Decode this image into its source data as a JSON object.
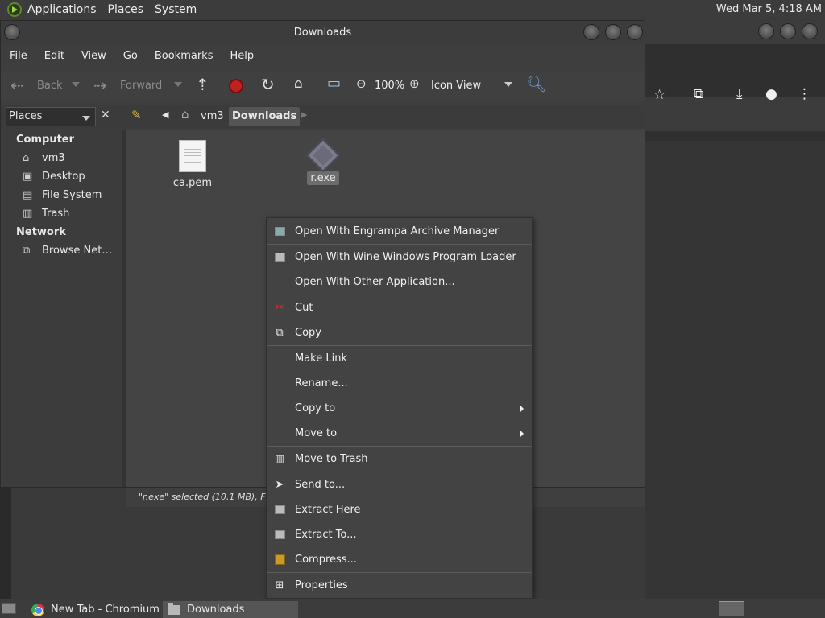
{
  "top_panel": {
    "menus": [
      "Applications",
      "Places",
      "System"
    ],
    "clock": "Wed Mar  5, 4:18 AM"
  },
  "window": {
    "title": "Downloads",
    "menubar": [
      "File",
      "Edit",
      "View",
      "Go",
      "Bookmarks",
      "Help"
    ],
    "toolbar": {
      "back": "Back",
      "forward": "Forward",
      "zoom": "100%",
      "view_mode": "Icon View"
    },
    "location": {
      "sidebar_select": "Places",
      "crumbs": [
        "vm3",
        "Downloads"
      ]
    },
    "sidebar": {
      "computer_heading": "Computer",
      "computer_items": [
        "vm3",
        "Desktop",
        "File System",
        "Trash"
      ],
      "network_heading": "Network",
      "network_items": [
        "Browse Net…"
      ]
    },
    "files": [
      {
        "name": "ca.pem",
        "icon": "text-file-icon"
      },
      {
        "name": "r.exe",
        "icon": "exe-file-icon",
        "selected": true
      }
    ],
    "status": "\"r.exe\" selected (10.1 MB), Free sp"
  },
  "context_menu": {
    "items": [
      {
        "label": "Open With Engrampa Archive Manager",
        "icon": "archive-manager-icon"
      },
      {
        "label": "Open With Wine Windows Program Loader",
        "icon": "wine-icon"
      },
      {
        "label": "Open With Other Application...",
        "icon": ""
      },
      {
        "label": "Cut",
        "icon": "scissors-icon"
      },
      {
        "label": "Copy",
        "icon": "copy-icon"
      },
      {
        "label": "Make Link",
        "icon": ""
      },
      {
        "label": "Rename...",
        "icon": ""
      },
      {
        "label": "Copy to",
        "icon": "",
        "submenu": true
      },
      {
        "label": "Move to",
        "icon": "",
        "submenu": true
      },
      {
        "label": "Move to Trash",
        "icon": "trash-icon"
      },
      {
        "label": "Send to...",
        "icon": "send-icon"
      },
      {
        "label": "Extract Here",
        "icon": "extract-icon"
      },
      {
        "label": "Extract To...",
        "icon": "extract-to-icon"
      },
      {
        "label": "Compress...",
        "icon": "compress-icon"
      },
      {
        "label": "Properties",
        "icon": "properties-icon"
      }
    ]
  },
  "taskbar": {
    "tasks": [
      "New Tab - Chromium",
      "Downloads"
    ]
  },
  "colors": {
    "panel": "#3c3c3c",
    "window": "#3e3e3e",
    "menu": "#434343",
    "selection": "#6d6d6d",
    "stop_red": "#c02020"
  }
}
